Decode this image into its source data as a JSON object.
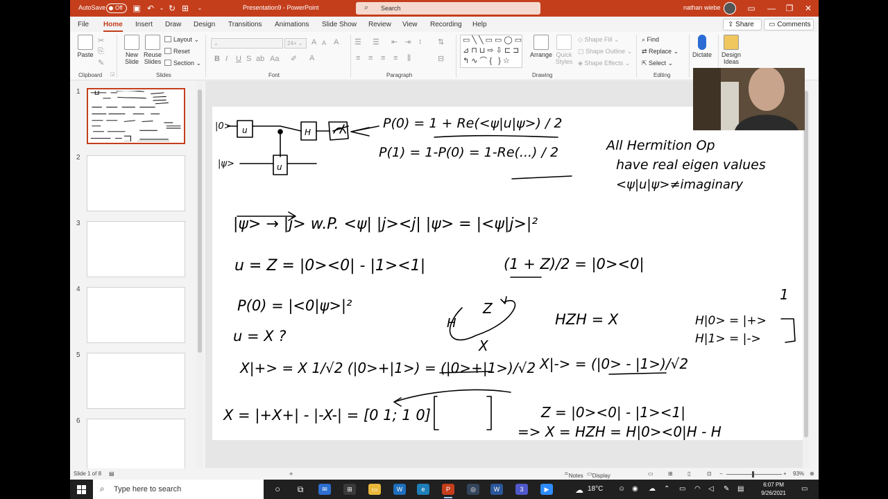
{
  "titlebar": {
    "autosave_label": "AutoSave",
    "autosave_state": "Off",
    "document_title": "Presentation9  -  PowerPoint",
    "search_placeholder": "Search",
    "user_name": "nathan wiebe"
  },
  "menu": {
    "tabs": [
      "File",
      "Home",
      "Insert",
      "Draw",
      "Design",
      "Transitions",
      "Animations",
      "Slide Show",
      "Review",
      "View",
      "Recording",
      "Help"
    ],
    "active_tab": "Home",
    "share_label": "Share",
    "comments_label": "Comments"
  },
  "ribbon": {
    "clipboard": {
      "paste": "Paste",
      "group": "Clipboard"
    },
    "slides": {
      "new_slide": "New Slide",
      "reuse_slides": "Reuse Slides",
      "layout": "Layout",
      "reset": "Reset",
      "section": "Section",
      "group": "Slides"
    },
    "font": {
      "size_placeholder": "24+",
      "bold": "B",
      "italic": "I",
      "underline": "U",
      "strike": "S",
      "group": "Font"
    },
    "paragraph": {
      "group": "Paragraph"
    },
    "drawing": {
      "arrange": "Arrange",
      "quick_styles": "Quick Styles",
      "shape_fill": "Shape Fill",
      "shape_outline": "Shape Outline",
      "shape_effects": "Shape Effects",
      "group": "Drawing"
    },
    "editing": {
      "find": "Find",
      "replace": "Replace",
      "select": "Select",
      "group": "Editing"
    },
    "voice": {
      "dictate": "Dictate"
    },
    "designer": {
      "design_ideas": "Design Ideas"
    }
  },
  "slides_pane": {
    "numbers": [
      "1",
      "2",
      "3",
      "4",
      "5",
      "6"
    ],
    "selected": 1
  },
  "slide_ink": {
    "circuit_label_0": "|0>",
    "circuit_label_psi": "|ψ>",
    "p0_formula": "P(0) = 1 + Re(<ψ|u|ψ>) / 2",
    "p1_formula": "P(1) = 1-P(0) = 1-Re(...) / 2",
    "note_line1": "All Hermition Op",
    "note_line2": "have real eigen values",
    "note_line3": "<ψ|u|ψ>≠imaginary",
    "line_measure": "|ψ> → |j> w.P.  <ψ| |j><j| |ψ> = |<ψ|j>|²",
    "line_u_z": "u = Z = |0><0| - |1><1|",
    "line_proj": "(1 + Z)/2 = |0><0|",
    "line_p0": "P(0) = |<0|ψ>|²",
    "line_u_x": "u = X ?",
    "line_hzh": "HZH = X",
    "line_h0": "H|0> = |+>",
    "line_h1": "H|1> = |->",
    "line_x_plus": "X|+> = X 1/√2 (|0>+|1>) = (|0>+|1>)/√2",
    "line_x_minus": "X|-> = (|0> - |1>)/√2",
    "line_x_matrix": "X = |+X+| - |-X-| = [0 1; 1 0]",
    "line_z_def": "Z = |0><0| - |1><1|",
    "line_x_hzh": "=> X = HZH = H|0><0|H - H"
  },
  "statusbar": {
    "slide_info": "Slide 1 of 8",
    "notes": "Notes",
    "display_settings": "Display Settings",
    "zoom": "93%"
  },
  "taskbar": {
    "search_placeholder": "Type here to search",
    "temperature": "18°C",
    "time": "6:07 PM",
    "date": "9/26/2021",
    "teams_badge": "3"
  }
}
